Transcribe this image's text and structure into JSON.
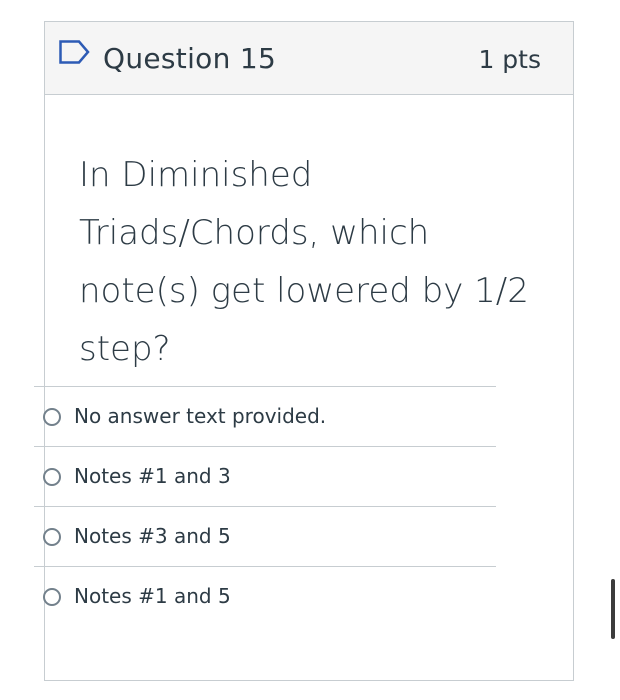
{
  "question": {
    "title": "Question 15",
    "points": "1 pts",
    "flag_icon": "flag-icon",
    "text": "In Diminished Triads/Chords, which note(s) get lowered by 1/2 step?"
  },
  "answers": [
    {
      "label": "No answer text provided.",
      "selected": false
    },
    {
      "label": "Notes #1 and 3",
      "selected": false
    },
    {
      "label": "Notes #3 and 5",
      "selected": false
    },
    {
      "label": "Notes #1 and 5",
      "selected": false
    }
  ],
  "colors": {
    "text": "#2d3b45",
    "border": "#c7cdd1",
    "header_bg": "#f5f5f5",
    "flag": "#2d5bb5",
    "radio_border": "#73818c"
  }
}
